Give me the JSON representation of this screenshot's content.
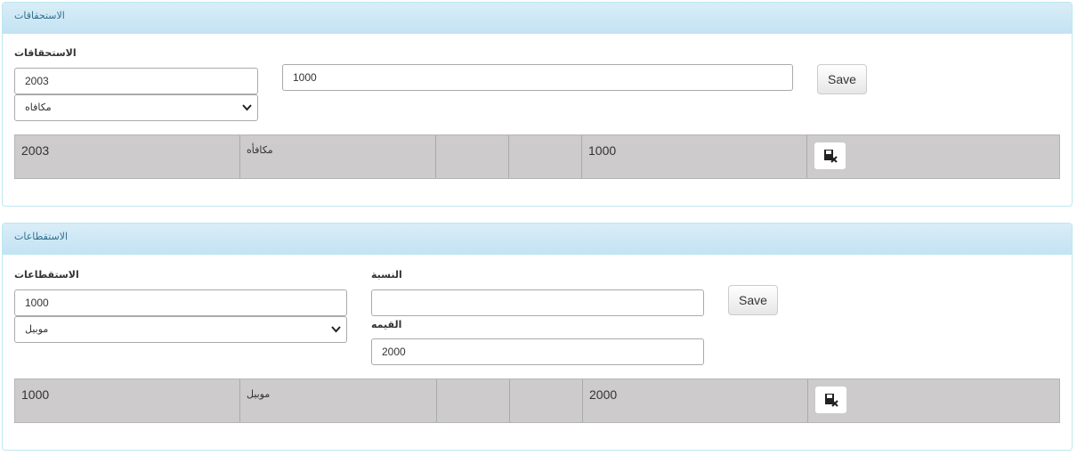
{
  "entitlements": {
    "heading": "الاستحقاقات",
    "field_label": "الاستحقاقات",
    "amount_value": "2003",
    "type_selected": "مكافاه",
    "value_input": "1000",
    "save_label": "Save",
    "row": {
      "cells": [
        "2003",
        "مكافأه",
        "",
        "",
        "1000"
      ],
      "action_icon": "delete-row-icon"
    }
  },
  "deductions": {
    "heading": "الاستقطاعات",
    "field_label": "الاستقطاعات",
    "percent_label": "النسبة",
    "value_label": "القيمه",
    "amount_value": "1000",
    "type_selected": "موبيل",
    "percent_value": "",
    "value_input": "2000",
    "save_label": "Save",
    "row": {
      "cells": [
        "1000",
        "موبيل",
        "",
        "",
        "2000"
      ],
      "action_icon": "delete-row-icon"
    }
  }
}
